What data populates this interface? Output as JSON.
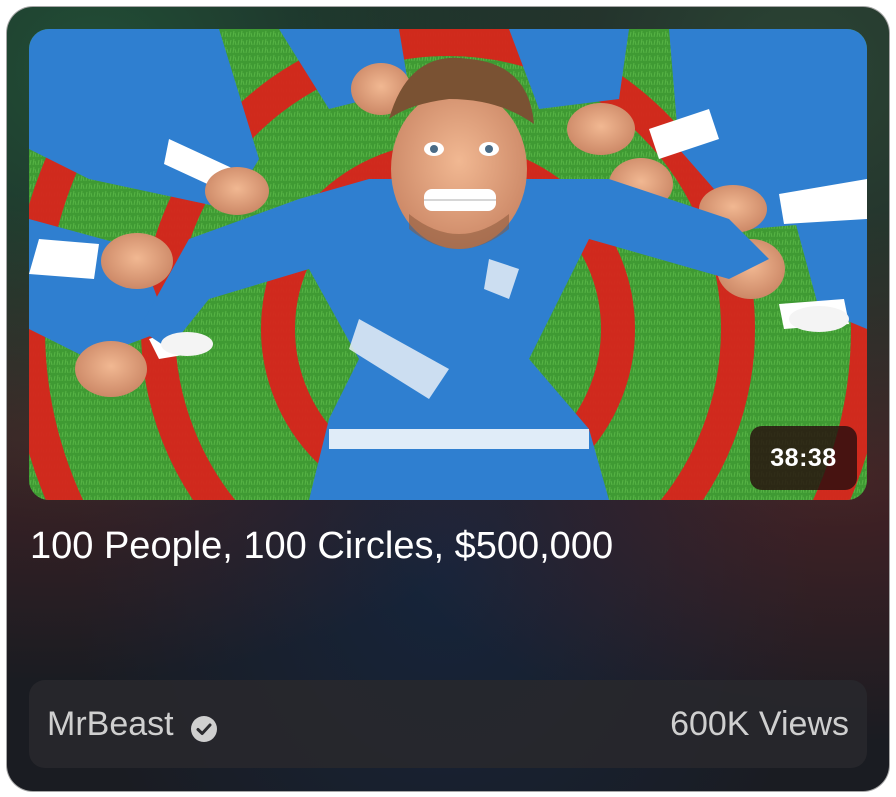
{
  "video": {
    "title": "100 People, 100 Circles, $500,000",
    "duration": "38:38",
    "channel": "MrBeast",
    "channel_verified": true,
    "views": "600K Views",
    "thumbnail_description_icon": "thumbnail-image"
  },
  "colors": {
    "grass": "#3f9a33",
    "circle_red": "#d8241c",
    "suit_blue": "#2f7fd0",
    "card_bg": "#1a1c22",
    "text_primary": "#ffffff",
    "text_secondary": "#cfcfcf"
  }
}
